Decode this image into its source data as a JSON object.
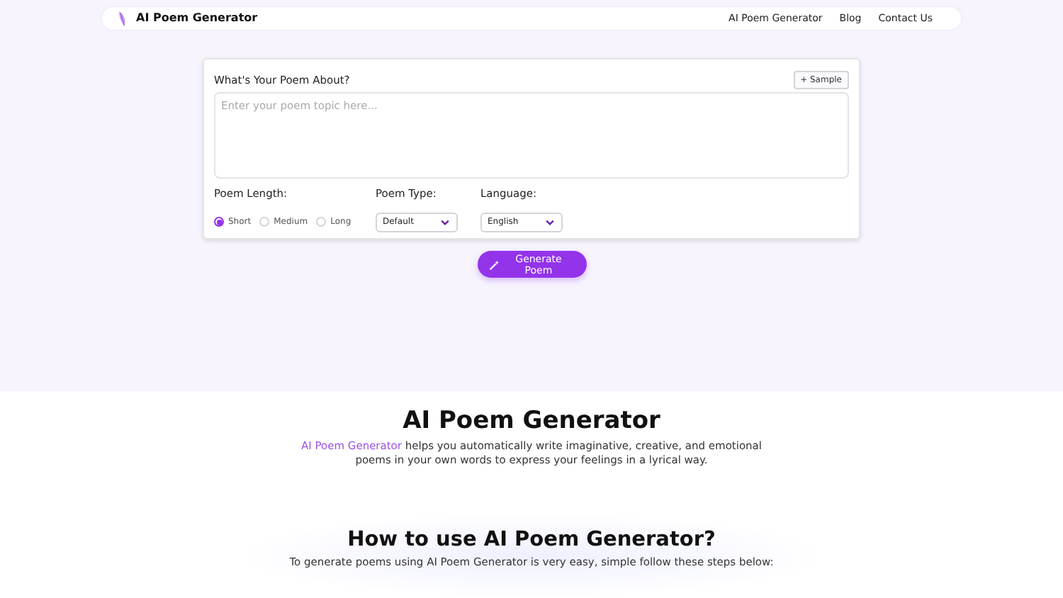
{
  "nav": {
    "brand": "AI Poem Generator",
    "links": [
      "AI Poem Generator",
      "Blog",
      "Contact Us"
    ]
  },
  "form": {
    "title": "What's Your Poem About?",
    "sample_button": "+ Sample",
    "topic": {
      "placeholder": "Enter your poem topic here..."
    },
    "length": {
      "label": "Poem Length:",
      "options": [
        {
          "label": "Short",
          "selected": true
        },
        {
          "label": "Medium",
          "selected": false
        },
        {
          "label": "Long",
          "selected": false
        }
      ]
    },
    "type": {
      "label": "Poem Type:",
      "value": "Default"
    },
    "language": {
      "label": "Language:",
      "value": "English"
    },
    "generate_button": "Generate Poem"
  },
  "intro": {
    "title": "AI Poem Generator",
    "link": "AI Poem Generator",
    "text": " helps you automatically write imaginative, creative, and emotional poems in your own words to express your feelings in a lyrical way."
  },
  "howto": {
    "title": "How to use AI Poem Generator?",
    "text": "To generate poems using AI Poem Generator is very easy, simple follow these steps below:"
  }
}
